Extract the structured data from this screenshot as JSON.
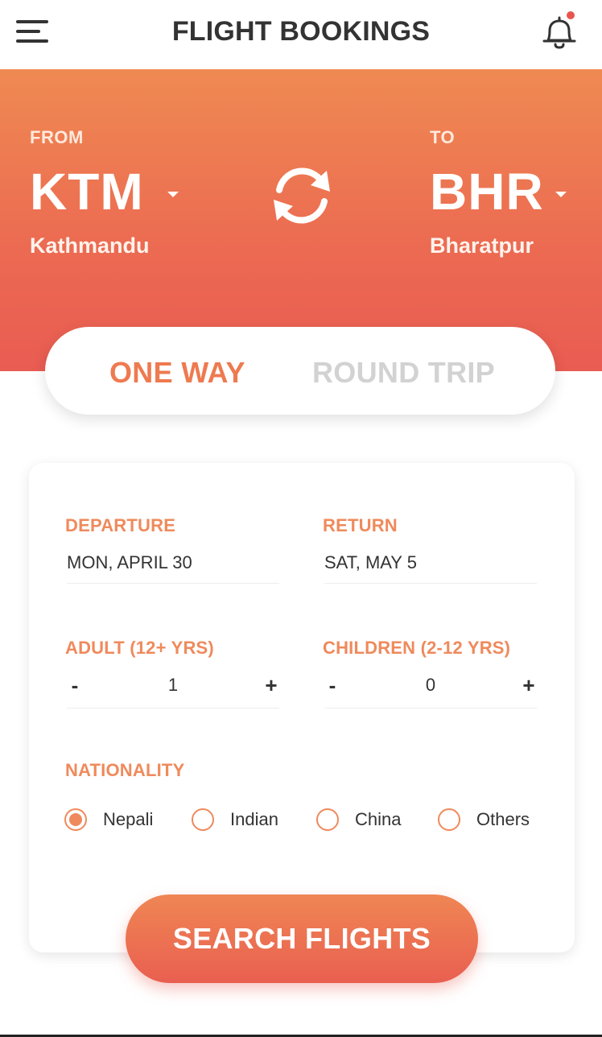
{
  "header": {
    "title": "FLIGHT BOOKINGS",
    "menu_icon": "hamburger-menu-icon",
    "notification_icon": "bell-icon",
    "notification_dot_color": "#e8554f"
  },
  "route": {
    "from_label": "FROM",
    "from_code": "KTM",
    "from_city": "Kathmandu",
    "to_label": "TO",
    "to_code": "BHR",
    "to_city": "Bharatpur",
    "swap_icon": "swap-refresh-icon"
  },
  "trip_type": {
    "options": [
      "ONE WAY",
      "ROUND TRIP"
    ],
    "selected": "ONE WAY"
  },
  "form": {
    "departure_label": "DEPARTURE",
    "departure_value": "MON, APRIL 30",
    "return_label": "RETURN",
    "return_value": "SAT, MAY 5",
    "adult_label": "ADULT (12+ YRS)",
    "adult_count": "1",
    "children_label": "CHILDREN (2-12 YRS)",
    "children_count": "0",
    "minus": "-",
    "plus": "+",
    "nationality_label": "NATIONALITY",
    "nationality_options": [
      "Nepali",
      "Indian",
      "China",
      "Others"
    ],
    "nationality_selected": "Nepali"
  },
  "search_button": "SEARCH FLIGHTS",
  "colors": {
    "accent": "#ee7a50",
    "gradient_top": "#ef8a52",
    "gradient_bottom": "#e95c52",
    "label_orange": "#ef8a5c",
    "inactive_text": "#d2d2d2"
  }
}
